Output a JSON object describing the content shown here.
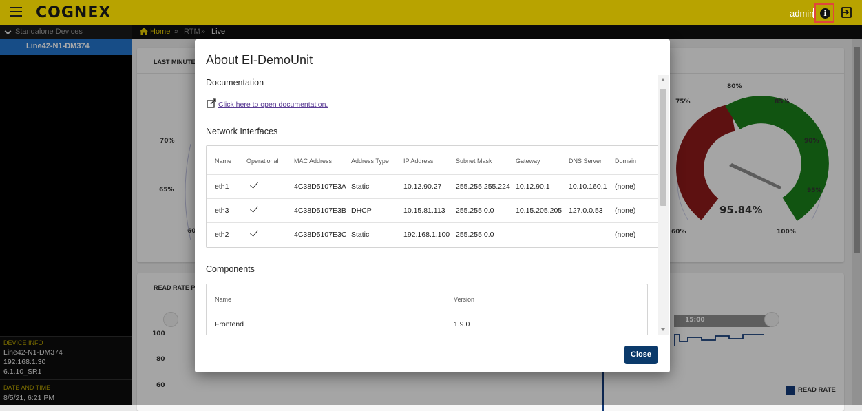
{
  "topbar": {
    "logo": "COGNEX",
    "user": "admin"
  },
  "breadcrumb": {
    "home": "Home",
    "sep1": "»",
    "item2": "RTM",
    "sep2": "»",
    "item3": "Live"
  },
  "sidebar": {
    "group_label": "Standalone Devices",
    "device": "Line42-N1-DM374",
    "device_info_label": "DEVICE INFO",
    "device_name": "Line42-N1-DM374",
    "device_ip": "192.168.1.30",
    "device_fw": "6.1.10_SR1",
    "datetime_label": "DATE AND TIME",
    "datetime": "8/5/21, 6:21 PM"
  },
  "background": {
    "panel1_title": "LAST MINUTE",
    "panel2_title": "READ RATE PE",
    "gauge_left_labels": [
      "70%",
      "65%",
      "60"
    ],
    "gauge_right_labels": [
      "80%",
      "75%",
      "85%",
      "90%",
      "95%",
      "60%",
      "100%"
    ],
    "gauge_value": "95.84%",
    "gauge_fraction": 0.9584,
    "chart_y_labels": [
      "100",
      "80",
      "60"
    ],
    "chart_time_label": "15:00",
    "legend_label": "READ RATE",
    "colors": {
      "red": "#8b1a1a",
      "green": "#1a7e1a",
      "line": "#123a78"
    }
  },
  "modal": {
    "title": "About EI-DemoUnit",
    "documentation_heading": "Documentation",
    "documentation_link": "Click here to open documentation.",
    "network_heading": "Network Interfaces",
    "network_columns": [
      "Name",
      "Operational",
      "MAC Address",
      "Address Type",
      "IP Address",
      "Subnet Mask",
      "Gateway",
      "DNS Server",
      "Domain"
    ],
    "network_rows": [
      {
        "name": "eth1",
        "mac": "4C38D5107E3A",
        "type": "Static",
        "ip": "10.12.90.27",
        "mask": "255.255.255.224",
        "gateway": "10.12.90.1",
        "dns": "10.10.160.1",
        "domain": "(none)"
      },
      {
        "name": "eth3",
        "mac": "4C38D5107E3B",
        "type": "DHCP",
        "ip": "10.15.81.113",
        "mask": "255.255.0.0",
        "gateway": "10.15.205.205",
        "dns": "127.0.0.53",
        "domain": "(none)"
      },
      {
        "name": "eth2",
        "mac": "4C38D5107E3C",
        "type": "Static",
        "ip": "192.168.1.100",
        "mask": "255.255.0.0",
        "gateway": "",
        "dns": "",
        "domain": "(none)"
      }
    ],
    "components_heading": "Components",
    "components_columns": [
      "Name",
      "Version"
    ],
    "components_rows": [
      {
        "name": "Frontend",
        "version": "1.9.0"
      }
    ],
    "close_label": "Close"
  }
}
